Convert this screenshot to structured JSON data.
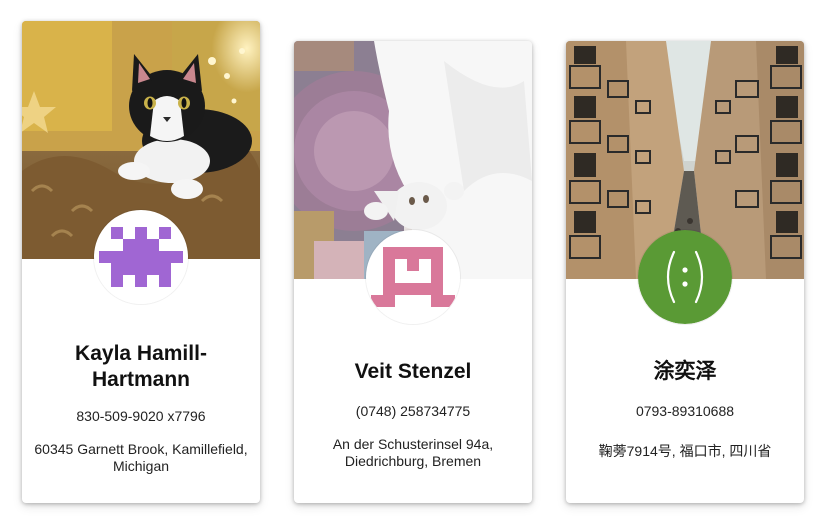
{
  "cards": [
    {
      "photo_subject": "black and white cat on fur rug",
      "avatar_icon": "pixel-identicon",
      "avatar_color": "#a066d3",
      "name": "Kayla Hamill-Hartmann",
      "phone": "830-509-9020 x7796",
      "address": "60345 Garnett Brook, Kamillefield, Michigan"
    },
    {
      "photo_subject": "white kitten on quilt",
      "avatar_icon": "pixel-identicon",
      "avatar_color": "#d9789a",
      "name": "Veit Stenzel",
      "phone": "(0748) 258734775",
      "address": "An der Schusterinsel 94a, Diedrichburg, Bremen"
    },
    {
      "photo_subject": "narrow city street with balconies",
      "avatar_icon": "emoticon-face",
      "avatar_color": "#5a9a35",
      "avatar_text": "(:)",
      "name": "涂奕泽",
      "phone": "0793-89310688",
      "address": "鞠蒡7914号, 福口市, 四川省"
    }
  ]
}
